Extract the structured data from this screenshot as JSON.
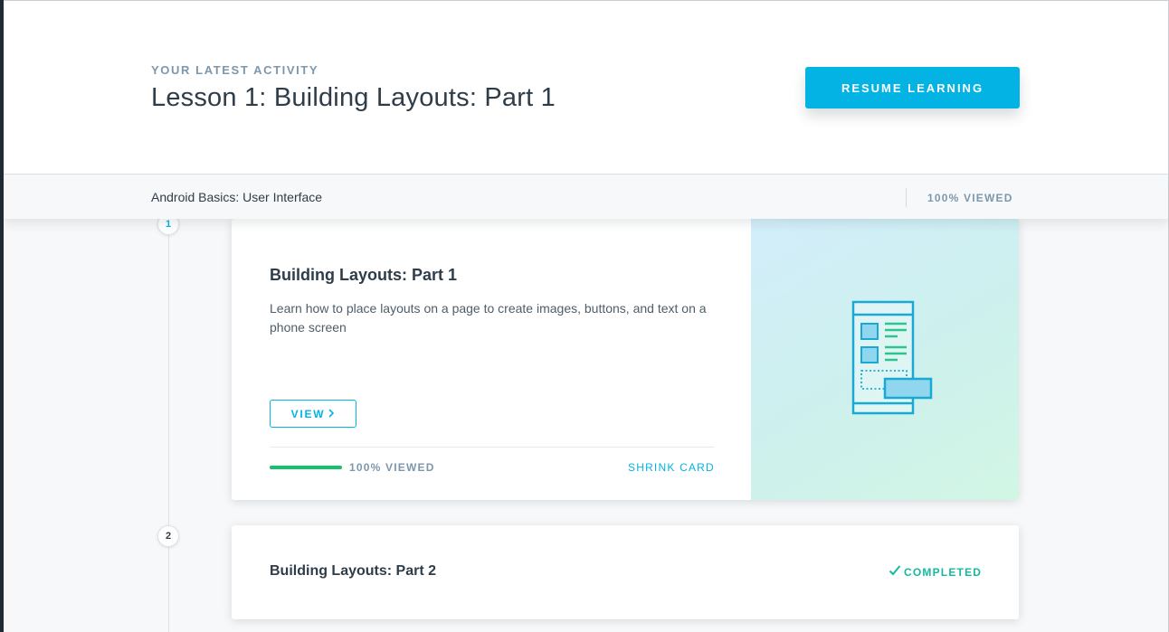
{
  "header": {
    "eyebrow": "YOUR LATEST ACTIVITY",
    "title": "Lesson 1: Building Layouts: Part 1",
    "resume_label": "RESUME LEARNING"
  },
  "course_bar": {
    "course_name": "Android Basics: User Interface",
    "viewed": "100% VIEWED"
  },
  "timeline": [
    {
      "number": "1",
      "title": "Building Layouts: Part 1",
      "description": "Learn how to place layouts on a page to create images, buttons, and text on a phone screen",
      "view_label": "VIEW",
      "view_icon": "chevron-right-icon",
      "progress_fraction": 1.0,
      "progress_label": "100% VIEWED",
      "shrink_label": "SHRINK CARD",
      "art_icon": "phone-layout-illustration"
    },
    {
      "number": "2",
      "title": "Building Layouts: Part 2",
      "status_icon": "checkmark-icon",
      "status": "COMPLETED"
    }
  ],
  "colors": {
    "accent": "#02b3e4",
    "progress": "#15c26b",
    "completed": "#15b9a0",
    "text": "#2e3d49",
    "muted": "#7d97ad"
  }
}
